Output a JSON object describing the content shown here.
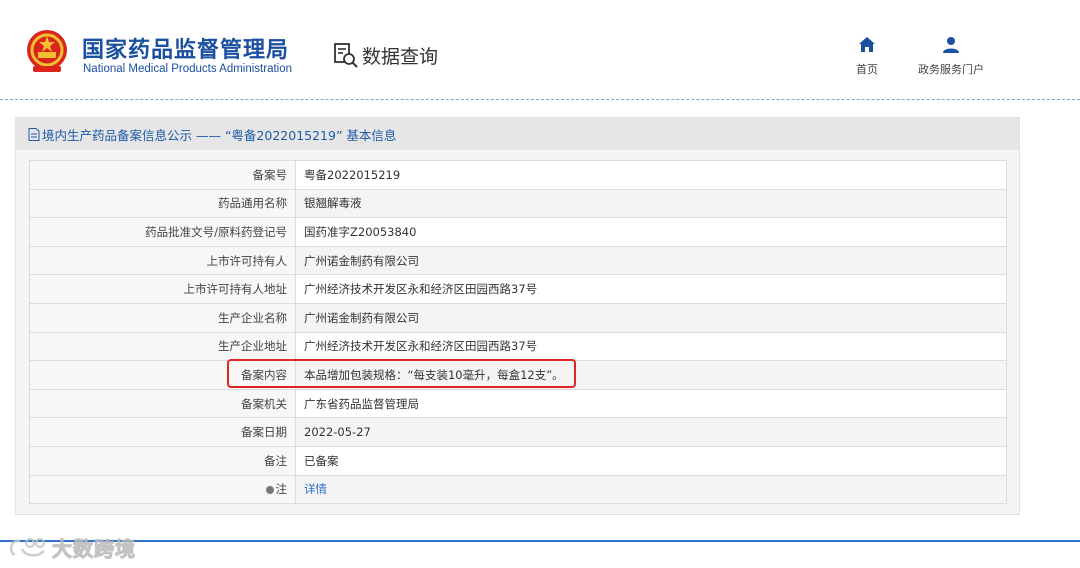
{
  "header": {
    "agency_cn": "国家药品监督管理局",
    "agency_en": "National Medical Products Administration",
    "section_title": "数据查询",
    "nav": [
      {
        "label": "首页",
        "icon": "home-icon"
      },
      {
        "label": "政务服务门户",
        "icon": "user-icon"
      }
    ]
  },
  "panel": {
    "title": "境内生产药品备案信息公示 —— “粤备2022015219” 基本信息"
  },
  "rows": [
    {
      "label": "备案号",
      "value": "粤备2022015219"
    },
    {
      "label": "药品通用名称",
      "value": "银翘解毒液"
    },
    {
      "label": "药品批准文号/原料药登记号",
      "value": "国药准字Z20053840"
    },
    {
      "label": "上市许可持有人",
      "value": "广州诺金制药有限公司"
    },
    {
      "label": "上市许可持有人地址",
      "value": "广州经济技术开发区永和经济区田园西路37号"
    },
    {
      "label": "生产企业名称",
      "value": "广州诺金制药有限公司"
    },
    {
      "label": "生产企业地址",
      "value": "广州经济技术开发区永和经济区田园西路37号"
    },
    {
      "label": "备案内容",
      "value": "本品增加包装规格：“每支装10毫升，每盒12支”。"
    },
    {
      "label": "备案机关",
      "value": "广东省药品监督管理局"
    },
    {
      "label": "备案日期",
      "value": "2022-05-27"
    },
    {
      "label": "备注",
      "value": "已备案"
    },
    {
      "label": "注",
      "value": "详情"
    }
  ],
  "watermark": "大数跨境",
  "colors": {
    "brand_blue": "#1b4fa0",
    "link_blue": "#2a6bd1",
    "highlight_red": "#e02424"
  }
}
